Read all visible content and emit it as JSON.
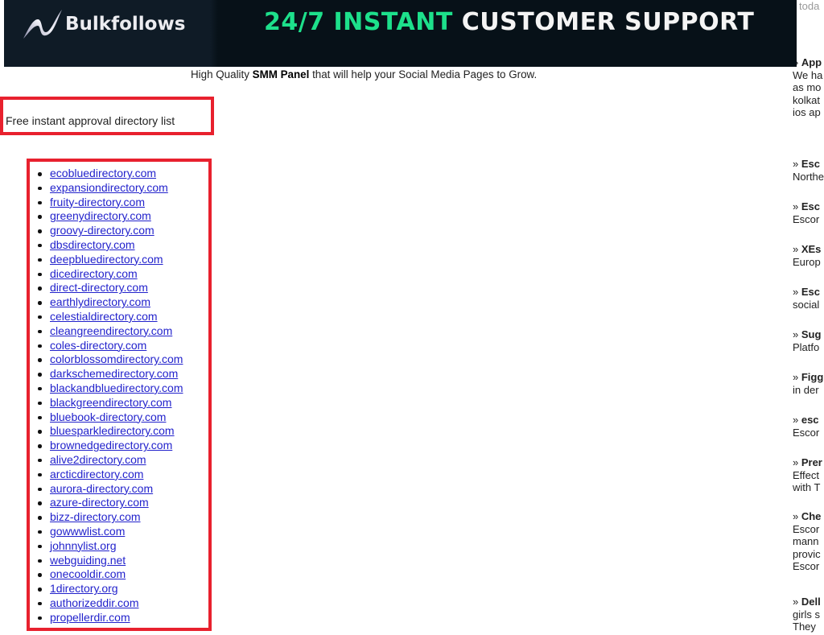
{
  "banner": {
    "logo_text": "Bulkfollows",
    "headline_green": "24/7 INSTANT",
    "headline_white": "CUSTOMER SUPPORT",
    "accent_color": "#1de08b"
  },
  "tagline": {
    "prefix": "High Quality ",
    "bold": "SMM Panel",
    "suffix": " that will help your Social Media Pages to Grow."
  },
  "section_title": "Free instant approval directory list",
  "directories": [
    "ecobluedirectory.com",
    "expansiondirectory.com",
    "fruity-directory.com",
    "greenydirectory.com",
    "groovy-directory.com",
    "dbsdirectory.com",
    "deepbluedirectory.com",
    "dicedirectory.com",
    "direct-directory.com",
    "earthlydirectory.com",
    "celestialdirectory.com",
    "cleangreendirectory.com",
    "coles-directory.com",
    "colorblossomdirectory.com",
    "darkschemedirectory.com",
    "blackandbluedirectory.com",
    "blackgreendirectory.com",
    "bluebook-directory.com",
    "bluesparkledirectory.com",
    "brownedgedirectory.com",
    "alive2directory.com",
    "arcticdirectory.com",
    "aurora-directory.com",
    "azure-directory.com",
    "bizz-directory.com",
    "gowwwlist.com",
    "johnnylist.org",
    "webguiding.net",
    "onecooldir.com",
    "1directory.org",
    "authorizeddir.com",
    "propellerdir.com"
  ],
  "sidebar": {
    "top_text": "toda",
    "entries": [
      {
        "title": "App",
        "lines": [
          "We ha",
          "as mo",
          "kolkat",
          "ios ap"
        ]
      },
      {
        "title": "Esc",
        "lines": [
          "Northe"
        ]
      },
      {
        "title": "Esc",
        "lines": [
          "Escor"
        ]
      },
      {
        "title": "XEs",
        "lines": [
          "Europ"
        ]
      },
      {
        "title": "Esc",
        "lines": [
          "social"
        ]
      },
      {
        "title": "Sug",
        "lines": [
          "Platfo"
        ]
      },
      {
        "title": "Figg",
        "lines": [
          "in der"
        ]
      },
      {
        "title": "esc",
        "lines": [
          "Escor"
        ]
      },
      {
        "title": "Prer",
        "lines": [
          "Effect",
          "with T"
        ]
      },
      {
        "title": "Che",
        "lines": [
          "Escor",
          "mann",
          "provic",
          "Escor"
        ]
      },
      {
        "title": "Dell",
        "lines": [
          "girls s",
          "They"
        ]
      }
    ]
  }
}
